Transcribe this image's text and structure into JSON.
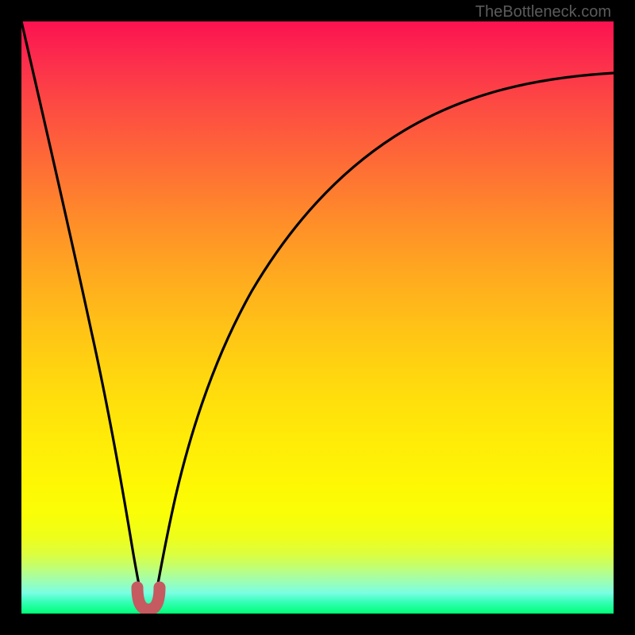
{
  "watermark_text": "TheBottleneck.com",
  "chart_data": {
    "type": "line",
    "title": "",
    "xlabel": "",
    "ylabel": "",
    "xlim_fraction": [
      0,
      1
    ],
    "ylim_percent": [
      0,
      100
    ],
    "y_axis_desc": "bottleneck percent (0 at bottom/green, 100 at top/red)",
    "x_axis_desc": "fraction of horizontal axis (0 left, 1 right)",
    "series": [
      {
        "name": "bottleneck-curve",
        "x": [
          0.0,
          0.03,
          0.06,
          0.09,
          0.12,
          0.15,
          0.17,
          0.19,
          0.2,
          0.21,
          0.22,
          0.23,
          0.25,
          0.28,
          0.32,
          0.37,
          0.43,
          0.5,
          0.58,
          0.67,
          0.77,
          0.88,
          1.0
        ],
        "y": [
          100,
          82,
          64,
          46,
          29,
          13,
          4,
          0,
          0,
          0,
          4,
          10,
          21,
          33,
          44,
          54,
          63,
          70,
          76,
          81,
          85,
          88,
          90
        ]
      },
      {
        "name": "optimal-marker",
        "x": [
          0.19,
          0.195,
          0.2,
          0.21,
          0.22,
          0.225,
          0.23
        ],
        "y": [
          4.5,
          1.5,
          0.5,
          0.0,
          0.5,
          1.5,
          4.5
        ]
      }
    ],
    "optimal_range_fraction": [
      0.19,
      0.23
    ],
    "background_gradient_note": "vertical gradient from red (top, high bottleneck) through orange/yellow to green (bottom, zero bottleneck)"
  },
  "colors": {
    "frame": "#000000",
    "curve": "#000000",
    "marker": "#c55a60",
    "watermark": "#5b5b5b"
  }
}
